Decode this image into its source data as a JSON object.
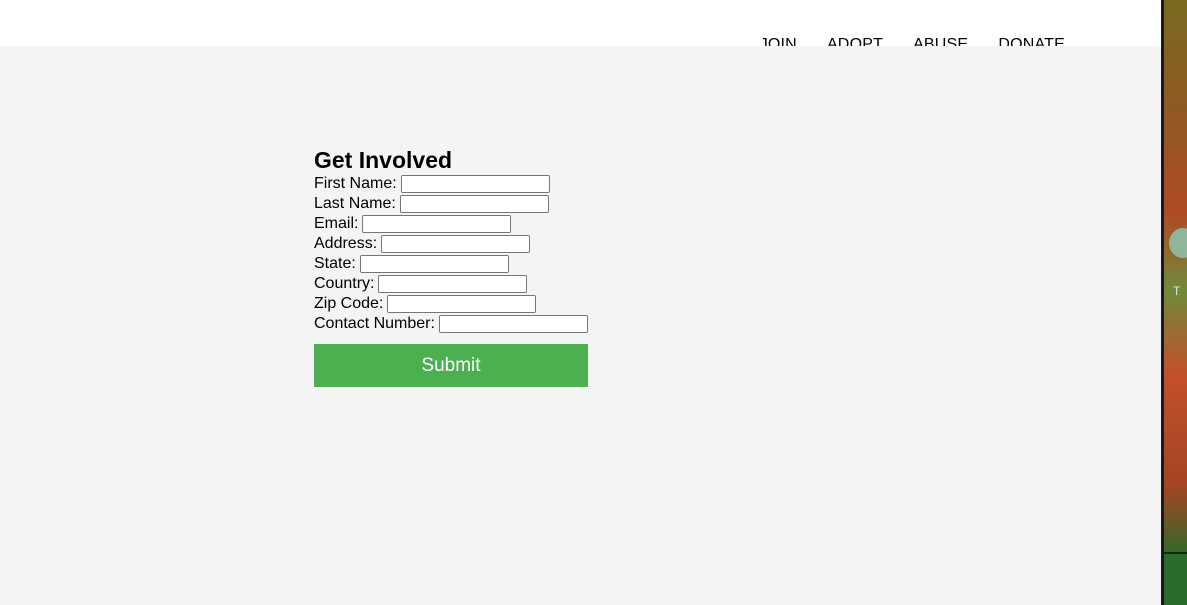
{
  "nav": {
    "items": [
      {
        "label": "JOIN"
      },
      {
        "label": "ADOPT"
      },
      {
        "label": "ABUSE"
      },
      {
        "label": "DONATE"
      }
    ]
  },
  "form": {
    "title": "Get Involved",
    "fields": [
      {
        "label": "First Name:",
        "value": ""
      },
      {
        "label": "Last Name:",
        "value": ""
      },
      {
        "label": "Email:",
        "value": ""
      },
      {
        "label": "Address:",
        "value": ""
      },
      {
        "label": "State:",
        "value": ""
      },
      {
        "label": "Country:",
        "value": ""
      },
      {
        "label": "Zip Code:",
        "value": ""
      },
      {
        "label": "Contact Number:",
        "value": ""
      }
    ],
    "submit_label": "Submit"
  },
  "side_strip": {
    "letter": "T"
  },
  "colors": {
    "page_background": "#f4f4f4",
    "header_background": "#ffffff",
    "submit_button": "#4caf50"
  }
}
